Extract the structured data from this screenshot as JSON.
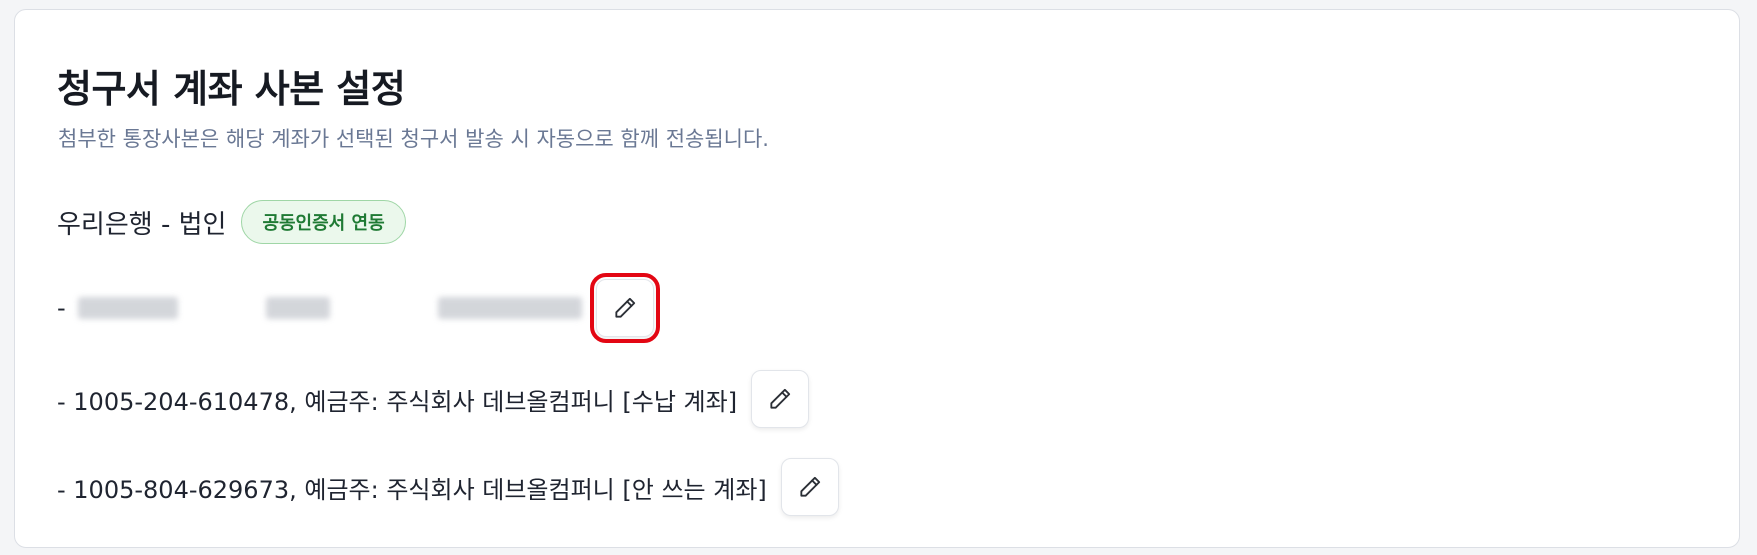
{
  "page": {
    "title": "청구서 계좌 사본 설정",
    "subtitle": "첨부한 통장사본은 해당 계좌가 선택된 청구서 발송 시 자동으로 함께 전송됩니다."
  },
  "bank": {
    "name": "우리은행 - 법인",
    "badge": "공동인증서 연동",
    "badge_color": "#1f7a34"
  },
  "accounts": [
    {
      "dash": "-",
      "text": "",
      "redacted": true,
      "edit_icon": "pencil-icon",
      "highlighted": true
    },
    {
      "text": "- 1005-204-610478, 예금주: 주식회사 데브올컴퍼니 [수납 계좌]",
      "edit_icon": "pencil-icon"
    },
    {
      "text": "- 1005-804-629673, 예금주: 주식회사 데브올컴퍼니 [안 쓰는 계좌]",
      "edit_icon": "pencil-icon"
    }
  ],
  "colors": {
    "highlight": "#e30613",
    "subtitle": "#6a7894"
  }
}
